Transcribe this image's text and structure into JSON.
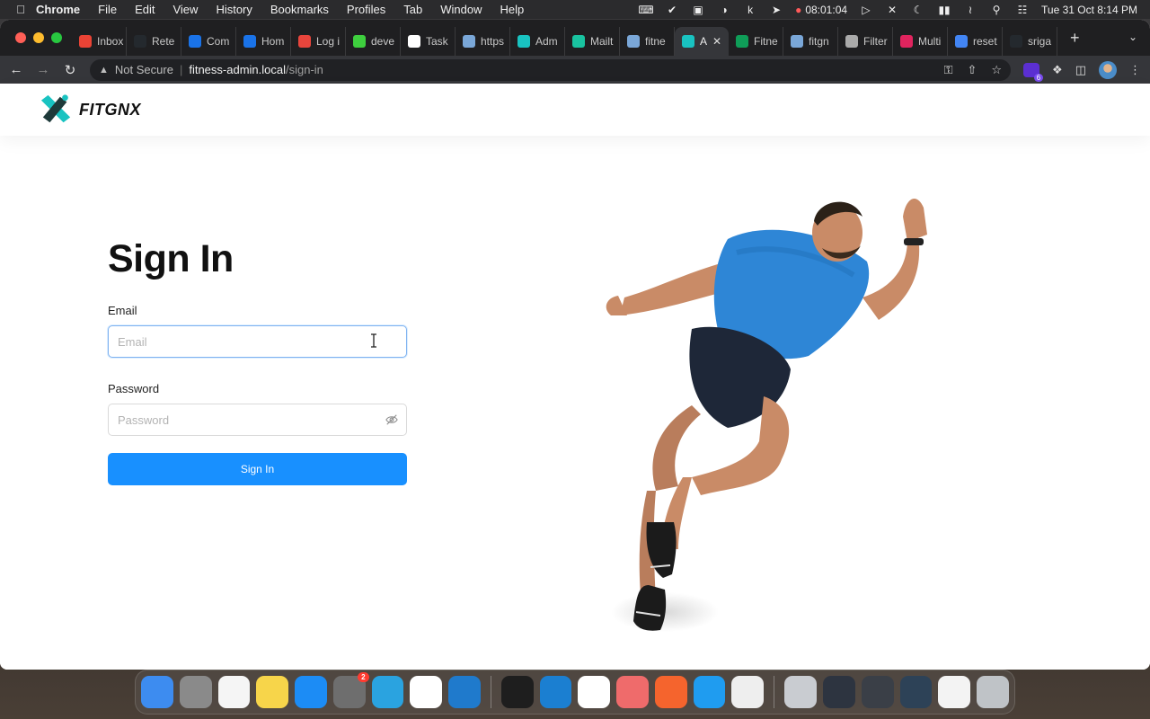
{
  "menubar": {
    "app": "Chrome",
    "items": [
      "File",
      "Edit",
      "View",
      "History",
      "Bookmarks",
      "Profiles",
      "Tab",
      "Window",
      "Help"
    ],
    "timer": "08:01:04",
    "datetime": "Tue 31 Oct  8:14 PM"
  },
  "browser": {
    "tabs": [
      {
        "label": "Inbox",
        "icon": "gmail-icon",
        "color": "#ea4335"
      },
      {
        "label": "Rete",
        "icon": "github-icon",
        "color": "#24292e"
      },
      {
        "label": "Com",
        "icon": "c-icon",
        "color": "#1a73e8"
      },
      {
        "label": "Hom",
        "icon": "c-icon",
        "color": "#1a73e8"
      },
      {
        "label": "Log i",
        "icon": "log-icon",
        "color": "#e8453c"
      },
      {
        "label": "deve",
        "icon": "dev-icon",
        "color": "#3ecf3e"
      },
      {
        "label": "Task",
        "icon": "task-icon",
        "color": "#ffffff"
      },
      {
        "label": "https",
        "icon": "link-icon",
        "color": "#7aa7d8"
      },
      {
        "label": "Adm",
        "icon": "fitgnx-icon",
        "color": "#19c3c1"
      },
      {
        "label": "Mailt",
        "icon": "mail-icon",
        "color": "#19c3a0"
      },
      {
        "label": "fitne",
        "icon": "link-icon",
        "color": "#7aa7d8"
      },
      {
        "label": "A",
        "icon": "fitgnx-icon",
        "color": "#19c3c1",
        "active": true
      },
      {
        "label": "Fitne",
        "icon": "sheets-icon",
        "color": "#0f9d58"
      },
      {
        "label": "fitgn",
        "icon": "link-icon",
        "color": "#7aa7d8"
      },
      {
        "label": "Filter",
        "icon": "cube-icon",
        "color": "#aaaaaa"
      },
      {
        "label": "Multi",
        "icon": "s-icon",
        "color": "#e0245e"
      },
      {
        "label": "reset",
        "icon": "google-icon",
        "color": "#4285f4"
      },
      {
        "label": "sriga",
        "icon": "github-icon",
        "color": "#24292e"
      }
    ],
    "security_label": "Not Secure",
    "url_host": "fitness-admin.local",
    "url_path": "/sign-in",
    "extension_badge": "6"
  },
  "site": {
    "brand": "FITGNX",
    "brand_color": "#19c3c1",
    "accent_color": "#1890ff"
  },
  "signin": {
    "title": "Sign In",
    "email_label": "Email",
    "email_placeholder": "Email",
    "password_label": "Password",
    "password_placeholder": "Password",
    "submit_label": "Sign In"
  },
  "dock": {
    "apps": [
      {
        "name": "finder-icon",
        "bg": "#3d8cf0"
      },
      {
        "name": "launchpad-icon",
        "bg": "#8a8a8a"
      },
      {
        "name": "reminders-icon",
        "bg": "#f5f5f5"
      },
      {
        "name": "notes-icon",
        "bg": "#f7d54a"
      },
      {
        "name": "app-store-icon",
        "bg": "#1c8cf5"
      },
      {
        "name": "system-settings-icon",
        "bg": "#6e6e6e",
        "badge": "2"
      },
      {
        "name": "telegram-icon",
        "bg": "#2aa3e0"
      },
      {
        "name": "chrome-icon",
        "bg": "#ffffff"
      },
      {
        "name": "vscode-icon",
        "bg": "#1f7acc"
      },
      {
        "name": "terminal-icon",
        "bg": "#1e1e1e"
      },
      {
        "name": "remote-desktop-icon",
        "bg": "#1b7fd1"
      },
      {
        "name": "mongodb-icon",
        "bg": "#ffffff"
      },
      {
        "name": "pastebot-icon",
        "bg": "#ef6b6b"
      },
      {
        "name": "sketch-tool-icon",
        "bg": "#f5642d"
      },
      {
        "name": "skype-icon",
        "bg": "#1f9cf0"
      },
      {
        "name": "textedit-icon",
        "bg": "#eeeeee"
      },
      {
        "name": "downloads-icon",
        "bg": "#c9ccd1"
      },
      {
        "name": "window-thumb-1-icon",
        "bg": "#2d3440"
      },
      {
        "name": "window-thumb-2-icon",
        "bg": "#3a3f47"
      },
      {
        "name": "window-thumb-3-icon",
        "bg": "#2d4257"
      },
      {
        "name": "window-thumb-4-icon",
        "bg": "#f3f3f3"
      },
      {
        "name": "trash-icon",
        "bg": "#bfc3c7"
      }
    ]
  }
}
